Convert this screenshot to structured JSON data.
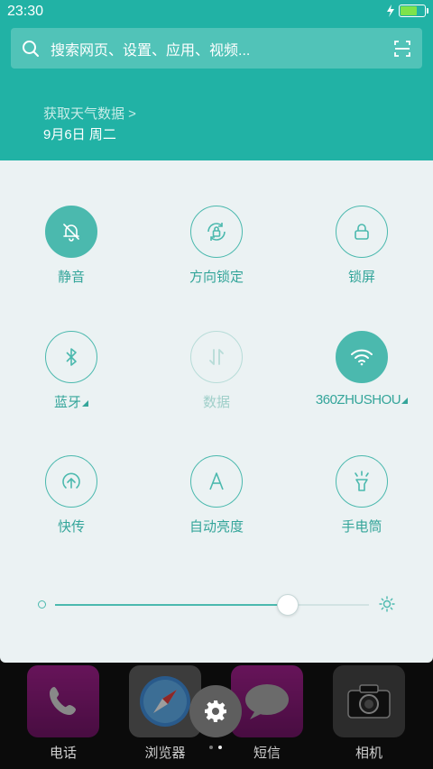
{
  "status_bar": {
    "time": "23:30",
    "battery_level": 0.7
  },
  "search": {
    "placeholder": "搜索网页、设置、应用、视频..."
  },
  "weather": {
    "link": "获取天气数据 >",
    "date": "9月6日 周二"
  },
  "tiles": [
    {
      "label": "静音",
      "state": "on",
      "icon": "bell-off-icon"
    },
    {
      "label": "方向锁定",
      "state": "normal",
      "icon": "rotation-lock-icon"
    },
    {
      "label": "锁屏",
      "state": "normal",
      "icon": "lock-icon"
    },
    {
      "label": "蓝牙",
      "state": "normal",
      "icon": "bluetooth-icon"
    },
    {
      "label": "数据",
      "state": "disabled",
      "icon": "data-arrows-icon"
    },
    {
      "label": "360ZHUSHOU",
      "state": "on",
      "icon": "wifi-icon"
    },
    {
      "label": "快传",
      "state": "normal",
      "icon": "share-upload-icon"
    },
    {
      "label": "自动亮度",
      "state": "normal",
      "icon": "auto-brightness-icon"
    },
    {
      "label": "手电筒",
      "state": "normal",
      "icon": "flashlight-icon"
    }
  ],
  "brightness": {
    "level": 0.74
  },
  "dock": [
    {
      "label": "电话",
      "icon": "phone-icon"
    },
    {
      "label": "浏览器",
      "icon": "compass-icon"
    },
    {
      "label": "短信",
      "icon": "message-icon"
    },
    {
      "label": "相机",
      "icon": "camera-icon"
    }
  ],
  "colors": {
    "accent": "#21b2a5",
    "tile_accent": "#4bb9ae",
    "panel_bg": "#ebf2f3"
  }
}
